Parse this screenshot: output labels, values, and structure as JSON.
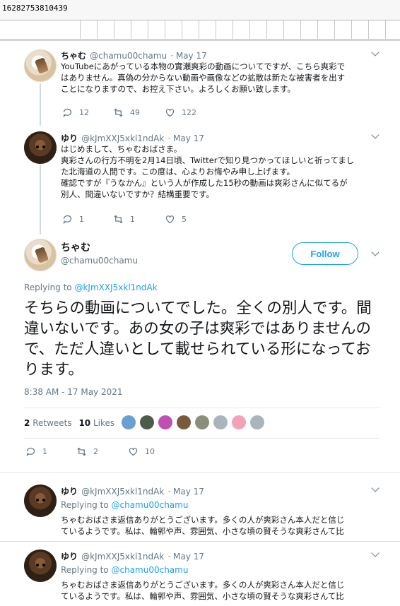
{
  "topbar": {
    "id_text": "16282753810439"
  },
  "tweet1": {
    "name": "ちゃむ",
    "handle": "@chamu00chamu",
    "date": "· May 17",
    "text": "YouTubeにあがっている本物の實瀬爽彩の動画についてですが、こちら爽彩で\nはありません。真偽の分からない動画や画像などの拡散は新たな被害者を出す\nことになりますので、お控え下さい。よろしくお願い致します。",
    "replies": "12",
    "retweets": "49",
    "likes": "122"
  },
  "tweet2": {
    "name": "ゆり",
    "handle": "@kJmXXJ5xkl1ndAk",
    "date": "· May 17",
    "text": "はじめまして、ちゃむおばさま。\n爽彩さんの行方不明を2月14日頃、Twitterで知り見つかってほしいと祈ってまし\nた北海道の人間です。この度は、心よりお悔やみ申し上げます。\n確認ですが『うなかん』という人が作成した15秒の動画は爽彩さんに似てるが\n別人、間違いないですか？結構重要です。",
    "replies": "1",
    "retweets": "1",
    "likes": "5"
  },
  "main_tweet": {
    "name": "ちゃむ",
    "handle": "@chamu00chamu",
    "follow_label": "Follow",
    "replying_prefix": "Replying to",
    "replying_to": "@kJmXXJ5xkl1ndAk",
    "text": "そちらの動画についてでした。全くの別人です。間違いないです。あの女の子は爽彩ではありませんので、ただ人違いとして載せられている形になっております。",
    "timestamp": "8:38 AM - 17 May 2021",
    "retweets_count": "2",
    "retweets_label": "Retweets",
    "likes_count": "10",
    "likes_label": "Likes",
    "replies": "1",
    "retweets": "2",
    "likes": "10"
  },
  "reply1": {
    "name": "ゆり",
    "handle": "@kJmXXJ5xkl1ndAk",
    "date": "· May 17",
    "replying_prefix": "Replying to",
    "replying_to": "@chamu00chamu",
    "text": "ちゃむおばさま返信ありがとうございます。多くの人が爽彩さん本人だと信じ\nているようです。私は、輪郭や声、雰囲気、小さな頃の賢そうな爽彩さんて比"
  },
  "reply2": {
    "name": "ゆり",
    "handle": "@kJmXXJ5xkl1ndAk",
    "date": "· May 17",
    "replying_prefix": "Replying to",
    "replying_to": "@chamu00chamu",
    "text": "ちゃむおばさま返信ありがとうございます。多くの人が爽彩さん本人だと信じ\nているようです。私は、輪郭や声、雰囲気、小さな頃の賢そうな爽彩さんて比"
  },
  "colors": {
    "accent": "#1da1f2",
    "muted": "#657786",
    "text": "#14171a"
  },
  "liker_colors": [
    "#6a9fd4",
    "#4f5b4a",
    "#c04fb3",
    "#7a5a3e",
    "#8b8f7a",
    "#a9b4bd",
    "#f2a3b8",
    "#a9b4bd"
  ]
}
